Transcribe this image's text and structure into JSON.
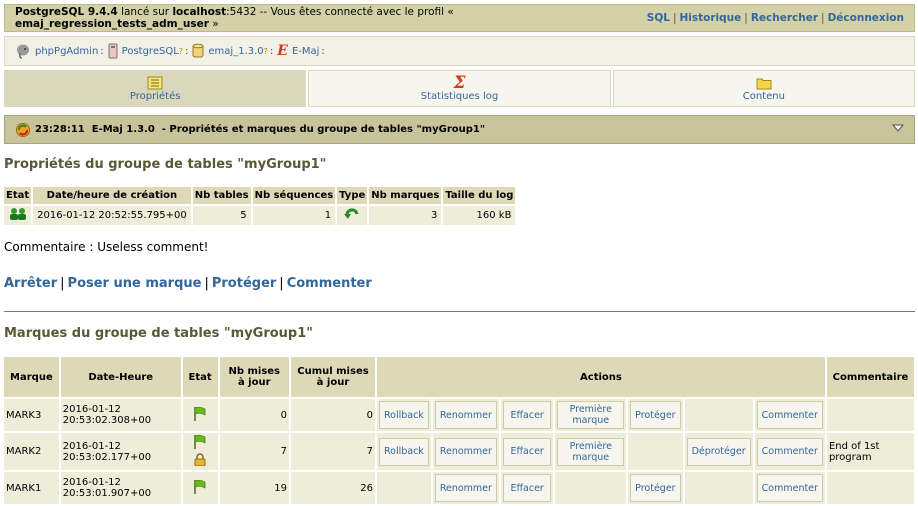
{
  "topbar": {
    "title_prefix": "PostgreSQL 9.4.4",
    "title_mid": " lancé sur ",
    "host": "localhost",
    "port": ":5432 -- Vous êtes connecté avec le profil « ",
    "user": "emaj_regression_tests_adm_user",
    "suffix": " »",
    "links": [
      "SQL",
      "Historique",
      "Rechercher",
      "Déconnexion"
    ]
  },
  "breadcrumb": [
    {
      "label": "phpPgAdmin",
      "icon": "elephant-icon",
      "help": ""
    },
    {
      "label": "PostgreSQL",
      "icon": "server-icon",
      "help": "?"
    },
    {
      "label": "emaj_1.3.0",
      "icon": "database-icon",
      "help": "?"
    },
    {
      "label": "E-Maj",
      "icon": "emaj-icon",
      "help": ""
    }
  ],
  "tabs": [
    {
      "label": "Propriétés",
      "icon": "properties-icon",
      "active": true
    },
    {
      "label": "Statistiques log",
      "icon": "sigma-icon",
      "active": false
    },
    {
      "label": "Contenu",
      "icon": "folder-icon",
      "active": false
    }
  ],
  "section_header": {
    "time": "23:28:11",
    "app": "E-Maj 1.3.0",
    "text": "-  Propriétés et marques du groupe de tables \"myGroup1\""
  },
  "properties": {
    "title": "Propriétés du groupe de tables \"myGroup1\"",
    "headers": [
      "Etat",
      "Date/heure de création",
      "Nb tables",
      "Nb séquences",
      "Type",
      "Nb marques",
      "Taille du log"
    ],
    "row": {
      "creation": "2016-01-12 20:52:55.795+00",
      "nb_tables": "5",
      "nb_sequences": "1",
      "nb_marks": "3",
      "log_size": "160 kB"
    },
    "comment": "Commentaire : Useless comment!"
  },
  "group_actions": [
    "Arrêter",
    "Poser une marque",
    "Protéger",
    "Commenter"
  ],
  "marks": {
    "title": "Marques du groupe de tables \"myGroup1\"",
    "headers": [
      "Marque",
      "Date-Heure",
      "Etat",
      "Nb mises à jour",
      "Cumul mises à jour",
      "Actions",
      "Commentaire"
    ],
    "rows": [
      {
        "mark": "MARK3",
        "date": "2016-01-12",
        "time": "20:53:02.308+00",
        "locked": false,
        "nb": "0",
        "cumul": "0",
        "actions": [
          "Rollback",
          "Renommer",
          "Effacer",
          "Première marque",
          "Protéger",
          "",
          "Commenter"
        ],
        "comment": ""
      },
      {
        "mark": "MARK2",
        "date": "2016-01-12",
        "time": "20:53:02.177+00",
        "locked": true,
        "nb": "7",
        "cumul": "7",
        "actions": [
          "Rollback",
          "Renommer",
          "Effacer",
          "Première marque",
          "",
          "Déprotéger",
          "Commenter"
        ],
        "comment": "End of 1st program"
      },
      {
        "mark": "MARK1",
        "date": "2016-01-12",
        "time": "20:53:01.907+00",
        "locked": false,
        "nb": "19",
        "cumul": "26",
        "actions": [
          "",
          "Renommer",
          "Effacer",
          "",
          "Protéger",
          "",
          "Commenter"
        ],
        "comment": ""
      }
    ]
  }
}
